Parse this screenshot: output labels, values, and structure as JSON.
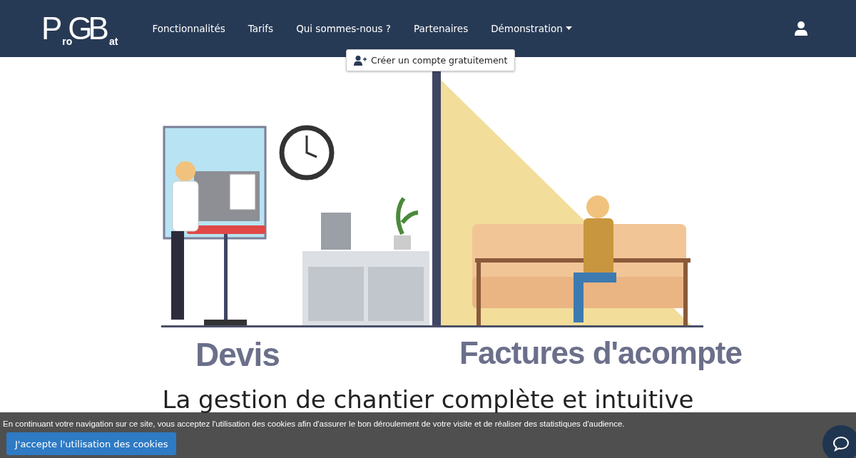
{
  "header": {
    "logo": {
      "parts": [
        "P",
        "ro",
        "G",
        "B",
        "at"
      ]
    },
    "nav": [
      {
        "label": "Fonctionnalités",
        "dropdown": false
      },
      {
        "label": "Tarifs",
        "dropdown": false
      },
      {
        "label": "Qui sommes-nous ?",
        "dropdown": false
      },
      {
        "label": "Partenaires",
        "dropdown": false
      },
      {
        "label": "Démonstration",
        "dropdown": true
      }
    ],
    "signup_button": "Créer un compte gratuitement"
  },
  "hero": {
    "captions": [
      "Devis",
      "Factures d'acompte"
    ],
    "heading": "La gestion de chantier complète et intuitive"
  },
  "cookie_banner": {
    "message": "En continuant votre navigation sur ce site, vous acceptez l'utilisation des cookies afin d'assurer le bon déroulement de votre visite et de réaliser des statistiques d'audience.",
    "accept_button": "J'accepte l'utilisation des cookies"
  }
}
